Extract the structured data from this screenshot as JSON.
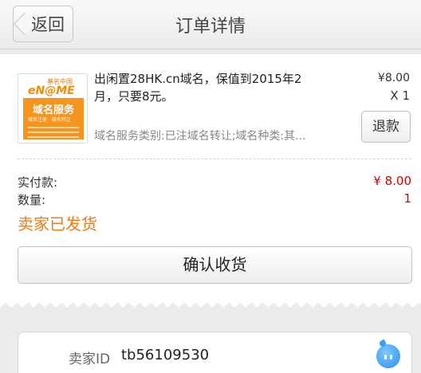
{
  "nav": {
    "back_label": "返回",
    "title": "订单详情"
  },
  "item": {
    "thumb_logo_cn": "基名中国",
    "thumb_logo_name": "eN@ME",
    "thumb_banner_title": "域名服务",
    "thumb_banner_sub": "域名注册 · 域名转让",
    "title": "出闲置28HK.cn域名，保值到2015年2月，只要8元。",
    "description": "域名服务类别:已注域名转让;域名种类:其...",
    "price": "¥8.00",
    "quantity": "X 1",
    "refund_label": "退款"
  },
  "summary": {
    "paid_label": "实付款:",
    "paid_value": "¥ 8.00",
    "count_label": "数量:",
    "count_value": "1",
    "status": "卖家已发货"
  },
  "confirm_label": "确认收货",
  "seller": {
    "label": "卖家ID",
    "id": "tb56109530"
  },
  "colors": {
    "price_red": "#d40000",
    "status_orange": "#f27b13",
    "chat_blue": "#2a8ff0"
  },
  "icons": {
    "back": "chevron-left-icon",
    "chat": "wangwang-chat-icon"
  }
}
